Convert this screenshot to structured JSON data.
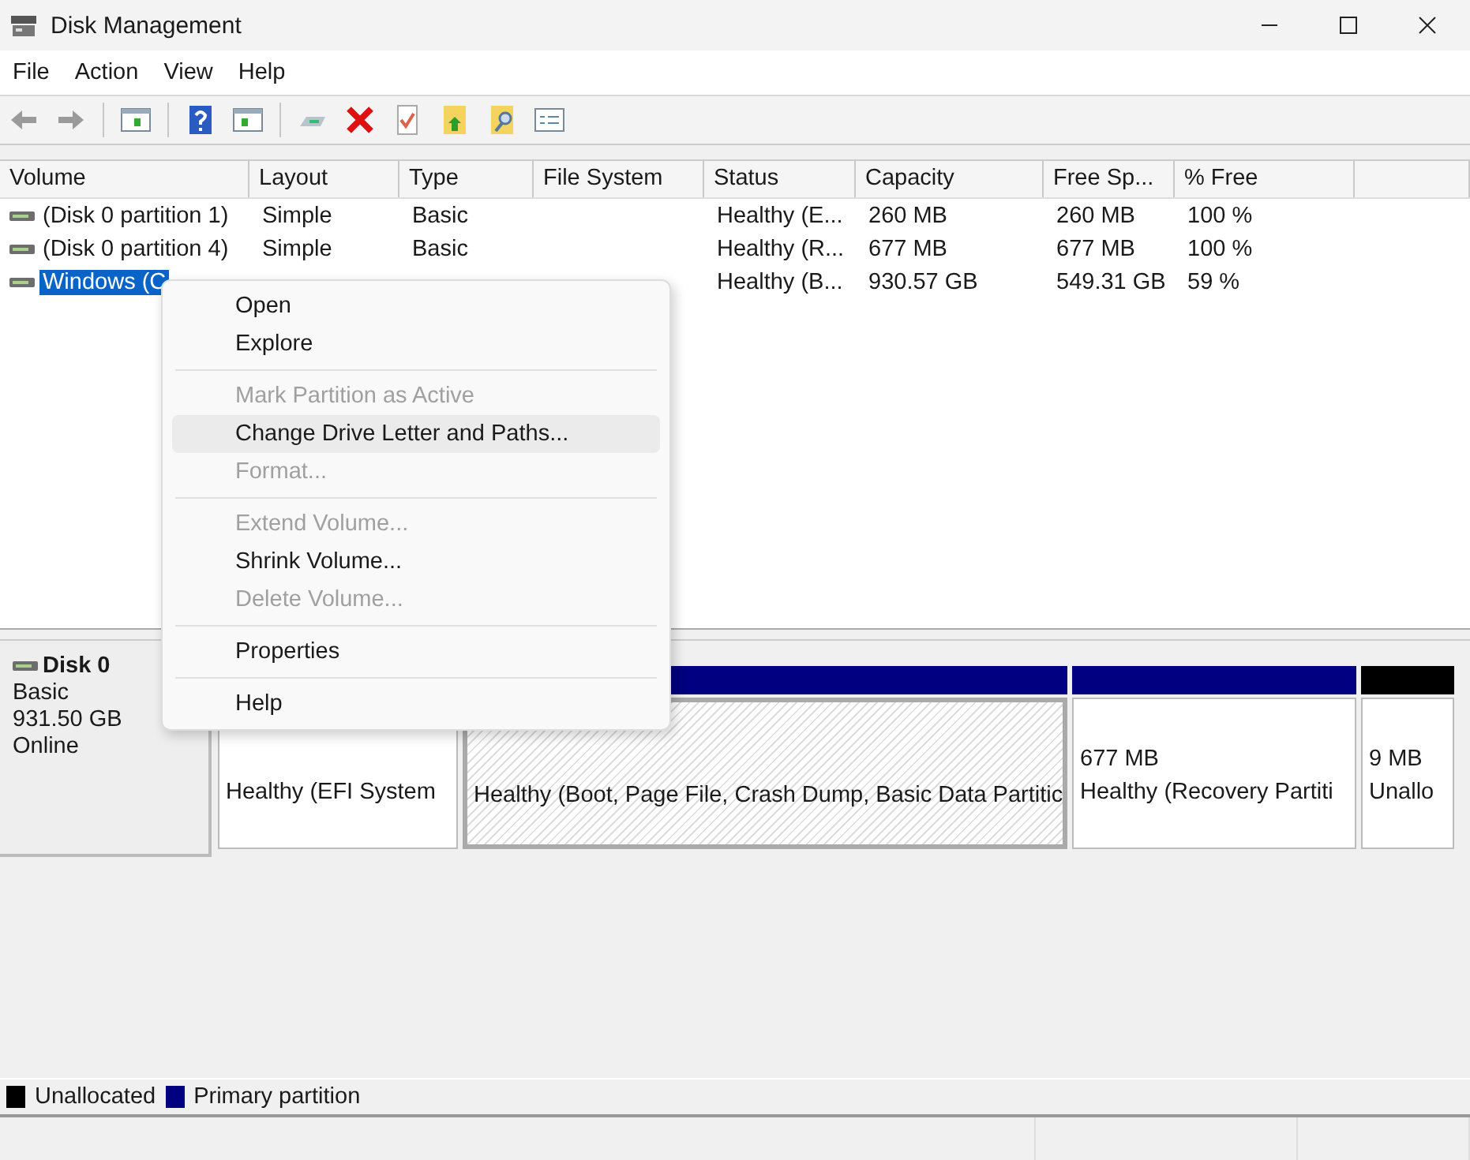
{
  "window": {
    "title": "Disk Management"
  },
  "menu_bar": [
    "File",
    "Action",
    "View",
    "Help"
  ],
  "table": {
    "columns": [
      "Volume",
      "Layout",
      "Type",
      "File System",
      "Status",
      "Capacity",
      "Free Sp...",
      "% Free"
    ],
    "rows": [
      {
        "selected": false,
        "cells": [
          "(Disk 0 partition 1)",
          "Simple",
          "Basic",
          "",
          "Healthy (E...",
          "260 MB",
          "260 MB",
          "100 %"
        ]
      },
      {
        "selected": false,
        "cells": [
          "(Disk 0 partition 4)",
          "Simple",
          "Basic",
          "",
          "Healthy (R...",
          "677 MB",
          "677 MB",
          "100 %"
        ]
      },
      {
        "selected": true,
        "cells": [
          "Windows (C",
          "",
          "",
          "",
          "Healthy (B...",
          "930.57 GB",
          "549.31 GB",
          "59 %"
        ]
      }
    ]
  },
  "disk": {
    "name": "Disk 0",
    "type": "Basic",
    "size": "931.50 GB",
    "state": "Online",
    "partitions": [
      {
        "selected": false,
        "status": "Healthy (EFI System"
      },
      {
        "color": "#000080",
        "selected": true,
        "status": "Healthy (Boot, Page File, Crash Dump, Basic Data Partitic"
      },
      {
        "color": "#000080",
        "selected": false,
        "size": "677 MB",
        "status": "Healthy (Recovery Partiti"
      },
      {
        "color": "#000000",
        "selected": false,
        "size": "9 MB",
        "status": "Unallo"
      }
    ]
  },
  "legend": [
    {
      "color": "#000000",
      "label": "Unallocated"
    },
    {
      "color": "#000080",
      "label": "Primary partition"
    }
  ],
  "context_menu": [
    {
      "kind": "item",
      "label": "Open",
      "disabled": false,
      "selected": false
    },
    {
      "kind": "item",
      "label": "Explore",
      "disabled": false,
      "selected": false
    },
    {
      "kind": "separator"
    },
    {
      "kind": "item",
      "label": "Mark Partition as Active",
      "disabled": true,
      "selected": false
    },
    {
      "kind": "item",
      "label": "Change Drive Letter and Paths...",
      "disabled": false,
      "selected": true
    },
    {
      "kind": "item",
      "label": "Format...",
      "disabled": true,
      "selected": false
    },
    {
      "kind": "separator"
    },
    {
      "kind": "item",
      "label": "Extend Volume...",
      "disabled": true,
      "selected": false
    },
    {
      "kind": "item",
      "label": "Shrink Volume...",
      "disabled": false,
      "selected": false
    },
    {
      "kind": "item",
      "label": "Delete Volume...",
      "disabled": true,
      "selected": false
    },
    {
      "kind": "separator"
    },
    {
      "kind": "item",
      "label": "Properties",
      "disabled": false,
      "selected": false
    },
    {
      "kind": "separator"
    },
    {
      "kind": "item",
      "label": "Help",
      "disabled": false,
      "selected": false
    }
  ]
}
